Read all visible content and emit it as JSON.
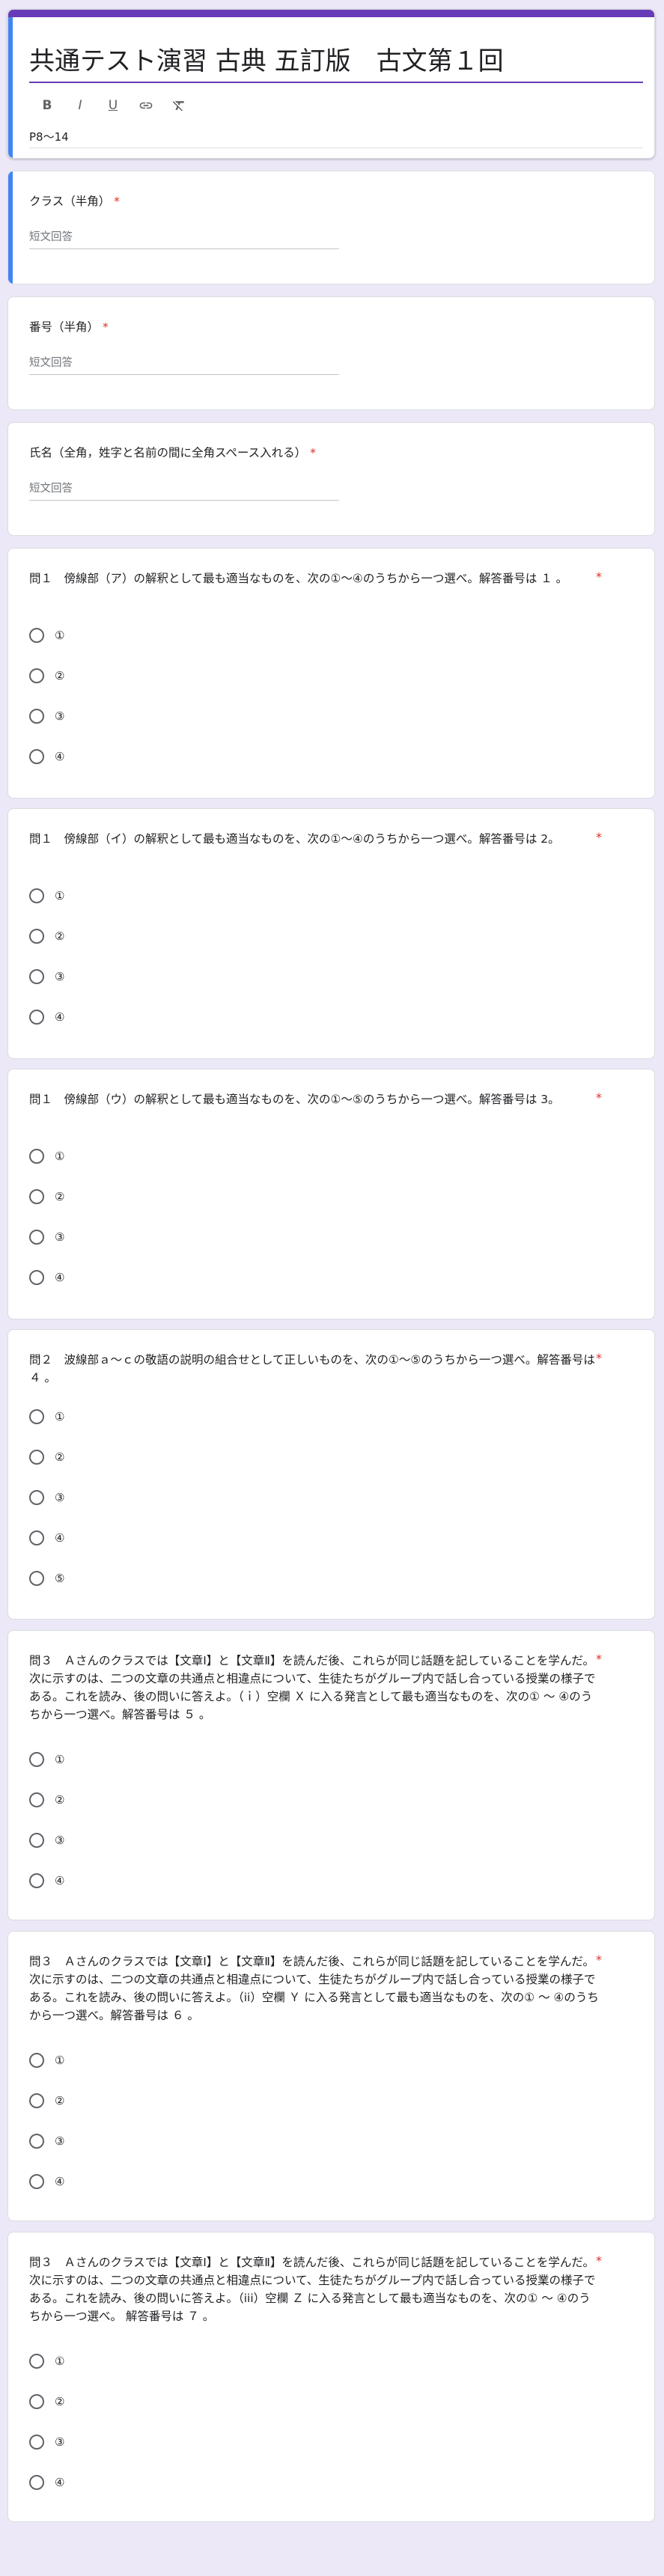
{
  "form": {
    "title": "共通テスト演習 古典 五訂版　古文第１回",
    "description": "P8〜14",
    "format_bar": [
      "B",
      "I",
      "U",
      "link-icon",
      "clear-format-icon"
    ]
  },
  "short_answer_placeholder": "短文回答",
  "required_mark": "*",
  "questions": [
    {
      "title": "クラス（半角）"
    },
    {
      "title": "番号（半角）"
    },
    {
      "title": "氏名（全角，姓字と名前の間に全角スペース入れる）"
    },
    {
      "title": "問１　傍線部（ア）の解釈として最も適当なものを、次の①〜④のうちから一つ選べ。解答番号は １ 。",
      "options": [
        "①",
        "②",
        "③",
        "④"
      ]
    },
    {
      "title": "問１　傍線部（イ）の解釈として最も適当なものを、次の①〜④のうちから一つ選べ。解答番号は 2。",
      "options": [
        "①",
        "②",
        "③",
        "④"
      ]
    },
    {
      "title": "問１　傍線部（ウ）の解釈として最も適当なものを、次の①〜⑤のうちから一つ選べ。解答番号は 3。",
      "options": [
        "①",
        "②",
        "③",
        "④"
      ]
    },
    {
      "title": "問２　波線部ａ〜ｃの敬語の説明の組合せとして正しいものを、次の①〜⑤のうちから一つ選べ。解答番号は ４ 。",
      "options": [
        "①",
        "②",
        "③",
        "④",
        "⑤"
      ]
    },
    {
      "title": "問３　Ａさんのクラスでは【文章Ⅰ】と【文章Ⅱ】を読んだ後、これらが同じ話題を記していることを学んだ。次に示すのは、二つの文章の共通点と相違点について、生徒たちがグループ内で話し合っている授業の様子である。これを読み、後の問いに答えよ。（ｉ）空欄 Ｘ に入る発言として最も適当なものを、次の① 〜 ④のうちから一つ選べ。解答番号は ５ 。",
      "options": [
        "①",
        "②",
        "③",
        "④"
      ]
    },
    {
      "title": "問３　Ａさんのクラスでは【文章Ⅰ】と【文章Ⅱ】を読んだ後、これらが同じ話題を記していることを学んだ。次に示すのは、二つの文章の共通点と相違点について、生徒たちがグループ内で話し合っている授業の様子である。これを読み、後の問いに答えよ。（ii）空欄 Ｙ に入る発言として最も適当なものを、次の① 〜 ④のうちから一つ選べ。解答番号は ６ 。",
      "options": [
        "①",
        "②",
        "③",
        "④"
      ]
    },
    {
      "title": "問３　Ａさんのクラスでは【文章Ⅰ】と【文章Ⅱ】を読んだ後、これらが同じ話題を記していることを学んだ。次に示すのは、二つの文章の共通点と相違点について、生徒たちがグループ内で話し合っている授業の様子である。これを読み、後の問いに答えよ。（iii）空欄 Ｚ に入る発言として最も適当なものを、次の① 〜 ④のうちから一つ選べ。 解答番号は ７ 。",
      "options": [
        "①",
        "②",
        "③",
        "④"
      ]
    }
  ],
  "colors": {
    "background": "#ece8f7",
    "accent": "#673ab7",
    "active_bar": "#4285f4",
    "required": "#d93025"
  }
}
